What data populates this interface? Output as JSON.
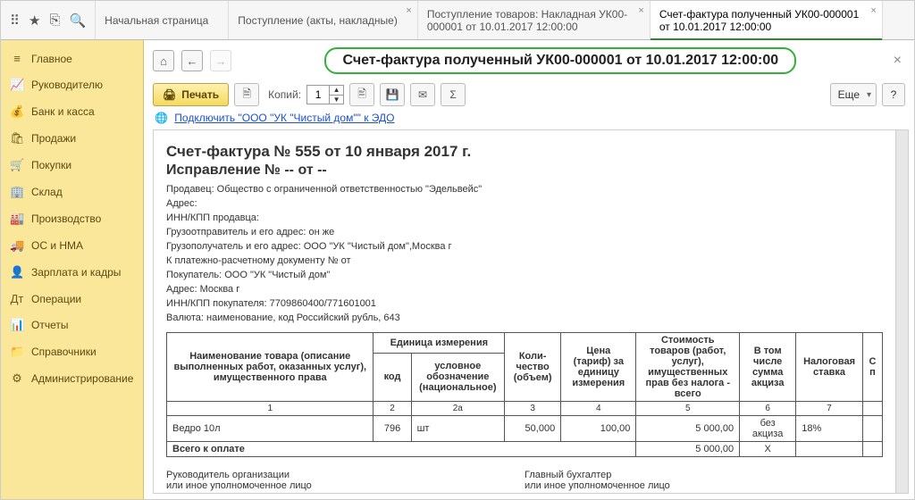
{
  "top_icons": {
    "apps": "⠿",
    "star": "★",
    "copy": "⎘",
    "search": "🔍"
  },
  "tabs": [
    {
      "label": "Начальная страница",
      "closable": false
    },
    {
      "label": "Поступление (акты, накладные)",
      "closable": true
    },
    {
      "label": "Поступление товаров: Накладная УК00-000001 от 10.01.2017 12:00:00",
      "closable": true
    },
    {
      "label": "Счет-фактура полученный УК00-000001 от 10.01.2017 12:00:00",
      "closable": true,
      "active": true
    }
  ],
  "sidebar": [
    {
      "icon": "≡",
      "label": "Главное"
    },
    {
      "icon": "📈",
      "label": "Руководителю"
    },
    {
      "icon": "💰",
      "label": "Банк и касса"
    },
    {
      "icon": "🛍",
      "label": "Продажи"
    },
    {
      "icon": "🛒",
      "label": "Покупки"
    },
    {
      "icon": "🏢",
      "label": "Склад"
    },
    {
      "icon": "🏭",
      "label": "Производство"
    },
    {
      "icon": "🚚",
      "label": "ОС и НМА"
    },
    {
      "icon": "👤",
      "label": "Зарплата и кадры"
    },
    {
      "icon": "Дт",
      "label": "Операции"
    },
    {
      "icon": "📊",
      "label": "Отчеты"
    },
    {
      "icon": "📁",
      "label": "Справочники"
    },
    {
      "icon": "⚙",
      "label": "Администрирование"
    }
  ],
  "title": "Счет-фактура полученный УК00-000001 от 10.01.2017 12:00:00",
  "toolbar": {
    "print": "Печать",
    "copies_label": "Копий:",
    "copies_value": "1",
    "more": "Еще",
    "help": "?"
  },
  "edo": {
    "prefix_icon": "🌐",
    "link": "Подключить \"ООО \"УК \"Чистый дом\"\" к ЭДО"
  },
  "doc": {
    "h1": "Счет-фактура № 555 от 10 января 2017 г.",
    "h2": "Исправление № -- от --",
    "lines": [
      "Продавец: Общество с ограниченной ответственностью \"Эдельвейс\"",
      "Адрес:",
      "ИНН/КПП продавца:",
      "Грузоотправитель и его адрес: он же",
      "Грузополучатель и его адрес: ООО \"УК \"Чистый дом\",Москва г",
      "К платежно-расчетному документу №    от",
      "Покупатель: ООО \"УК \"Чистый дом\"",
      "Адрес: Москва г",
      "ИНН/КПП покупателя: 7709860400/771601001",
      "Валюта: наименование, код Российский рубль, 643"
    ],
    "headers": {
      "name": "Наименование товара (описание выполненных работ, оказанных услуг), имущественного права",
      "unit": "Единица измерения",
      "code": "код",
      "uname": "условное обозначение (национальное)",
      "qty": "Коли-чество (объем)",
      "price": "Цена (тариф) за единицу измерения",
      "sum": "Стоимость товаров (работ, услуг), имущественных прав без налога - всего",
      "excise": "В том числе сумма акциза",
      "taxrate": "Налоговая ставка",
      "last": "С п"
    },
    "colnums": [
      "1",
      "2",
      "2а",
      "3",
      "4",
      "5",
      "6",
      "7"
    ],
    "row": {
      "name": "Ведро 10л",
      "code": "796",
      "unit": "шт",
      "qty": "50,000",
      "price": "100,00",
      "sum": "5 000,00",
      "excise": "без акциза",
      "tax": "18%"
    },
    "total": {
      "label": "Всего к оплате",
      "sum": "5 000,00",
      "x": "X"
    },
    "sig": {
      "left1": "Руководитель организации",
      "left2": "или иное уполномоченное лицо",
      "right1": "Главный бухгалтер",
      "right2": "или иное уполномоченное лицо"
    }
  }
}
